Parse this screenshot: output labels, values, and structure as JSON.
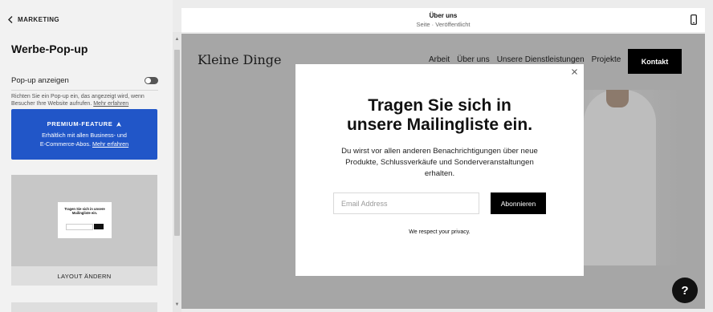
{
  "sidebar": {
    "back_label": "MARKETING",
    "title": "Werbe-Pop-up",
    "toggle_label": "Pop-up anzeigen",
    "toggle_on": false,
    "description": "Richten Sie ein Pop-up ein, das angezeigt wird, wenn Besucher Ihre Website aufrufen.",
    "description_link": "Mehr erfahren",
    "premium": {
      "title": "PREMIUM-FEATURE",
      "body_line1": "Erhältlich mit allen Business- und",
      "body_line2": "E-Commerce-Abos.",
      "link": "Mehr erfahren",
      "color": "#2156c8"
    },
    "thumbnail_title_line1": "Tragen Sie sich in unsere",
    "thumbnail_title_line2": "Mailingliste ein.",
    "layout_button": "LAYOUT ÄNDERN"
  },
  "preview_header": {
    "title": "Über uns",
    "subtitle": "Seite · Veröffentlicht",
    "device_icon": "mobile-icon"
  },
  "site": {
    "logo": "Kleine Dinge",
    "nav": [
      "Arbeit",
      "Über uns",
      "Unsere Dienstleistungen",
      "Projekte"
    ],
    "contact_button": "Kontakt"
  },
  "popup": {
    "title_line1": "Tragen Sie sich in",
    "title_line2": "unsere Mailingliste ein.",
    "body_line1": "Du wirst vor allen anderen Benachrichtigungen über neue",
    "body_line2": "Produkte, Schlussverkäufe und Sonderveranstaltungen",
    "body_line3": "erhalten.",
    "email_placeholder": "Email Address",
    "subscribe_button": "Abonnieren",
    "privacy": "We respect your privacy."
  },
  "help_button": "?"
}
